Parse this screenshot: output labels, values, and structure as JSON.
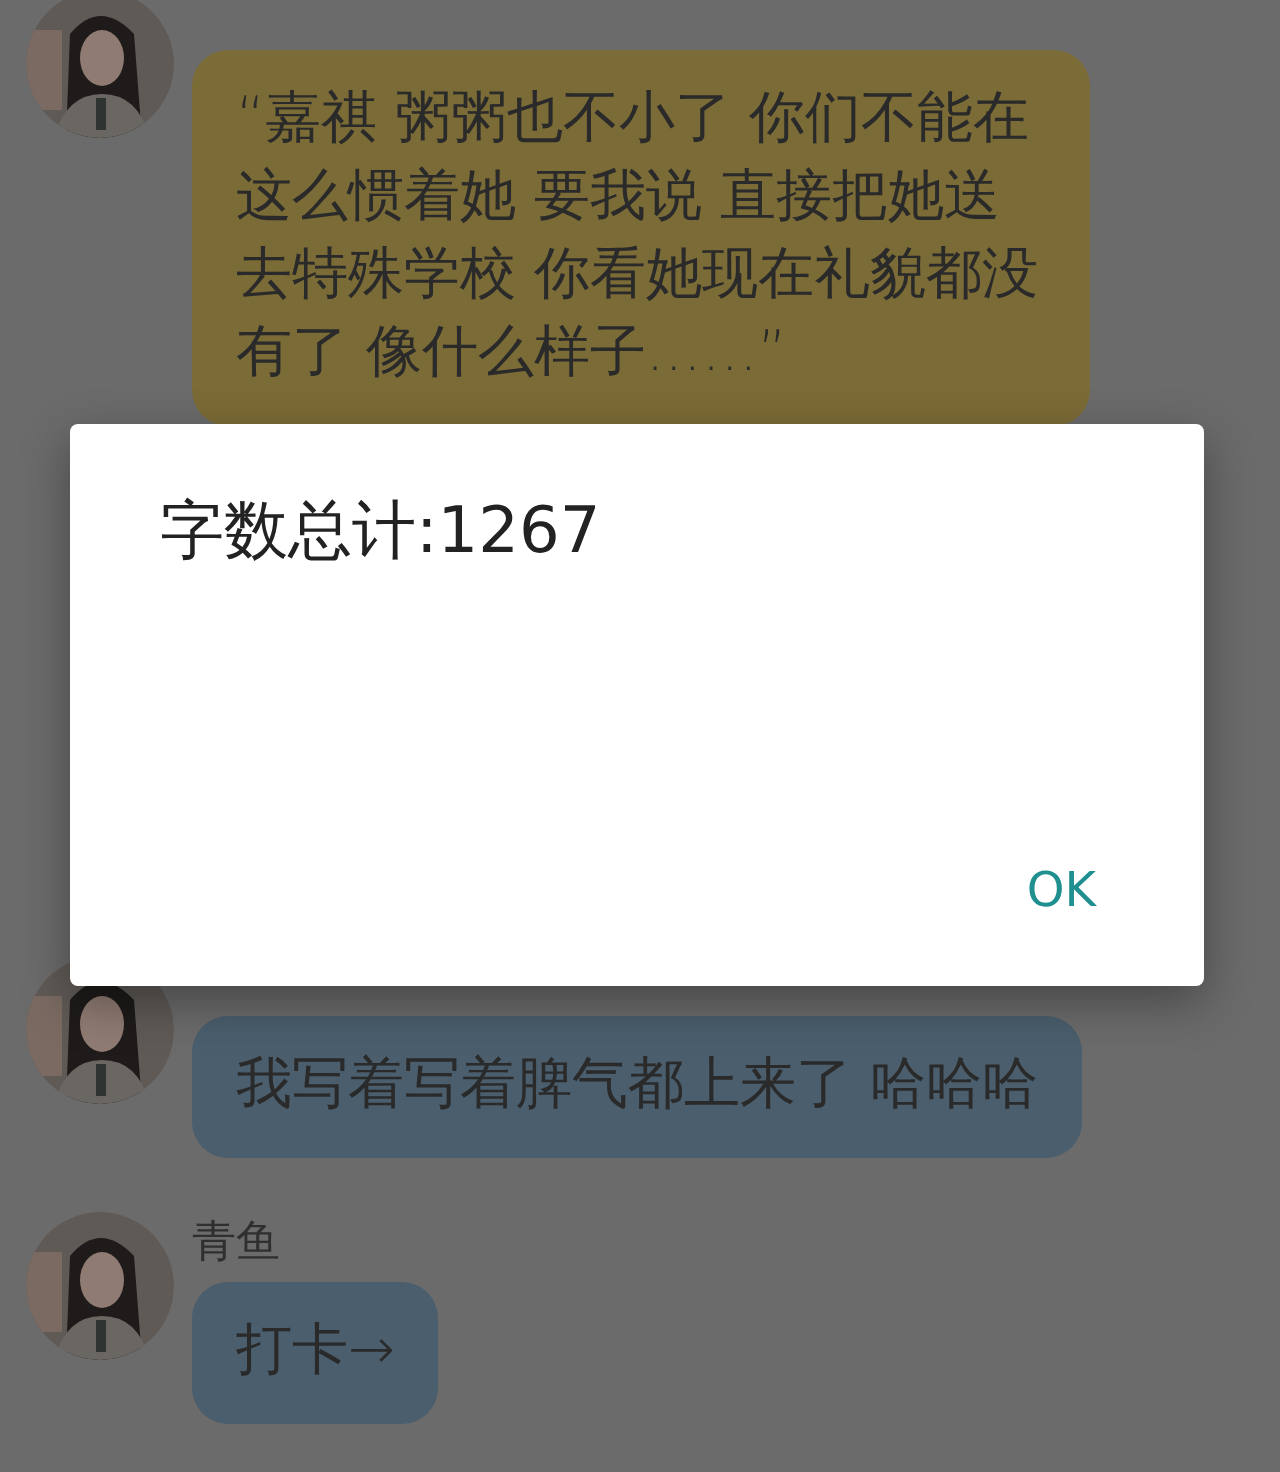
{
  "messages": [
    {
      "text": "“嘉祺 粥粥也不小了 你们不能在这么惯着她 要我说 直接把她送去特殊学校 你看她现在礼貌都没有了 像什么样子……”",
      "color": "#7b6b36"
    },
    {
      "text": "我写着写着脾气都上来了 哈哈哈",
      "color": "#4a5e6d"
    },
    {
      "name": "青鱼",
      "text": "打卡→",
      "color": "#4a5e6d"
    }
  ],
  "dialog": {
    "title": "字数总计:1267",
    "buttons": [
      "OK"
    ]
  }
}
